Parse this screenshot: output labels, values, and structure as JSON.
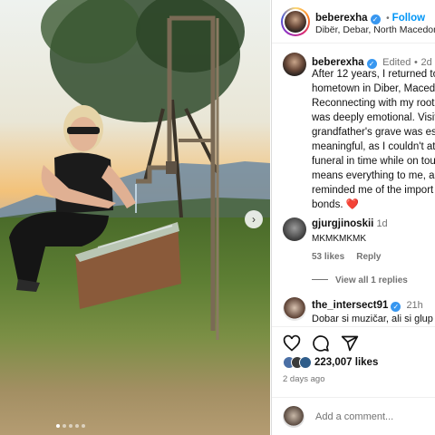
{
  "post": {
    "author": "beberexha",
    "follow_label": "Follow",
    "location": "Dibër, Debar, North Macedonia",
    "edited_label": "Edited",
    "edited_time": "2d",
    "caption_lines": [
      "After 12 years, I returned to",
      "hometown in Diber, Maced",
      "Reconnecting with my roots",
      "was deeply emotional. Visit",
      "grandfather's grave was esp",
      "meaningful, as I couldn't att",
      "funeral in time while on tou",
      "means everything to me, ar",
      "reminded me of the import",
      "bonds."
    ],
    "heart_emoji": "❤️"
  },
  "comments": [
    {
      "username": "gjurgjinoskii",
      "time": "1d",
      "text": "MKMKMKMK",
      "likes": "53 likes",
      "reply_label": "Reply"
    },
    {
      "username": "the_intersect91",
      "time": "21h",
      "text": "Dobar si muzičar, ali si glup"
    }
  ],
  "view_replies": "View all 1 replies",
  "likes": {
    "count": "223,007 likes"
  },
  "posted_ago": "2 days ago",
  "add_comment_placeholder": "Add a comment...",
  "carousel": {
    "next_icon": "›",
    "dot_count": 5,
    "active_index": 0
  },
  "colors": {
    "accent": "#0095f6",
    "verified": "#3897f0",
    "heart": "#ed4956"
  }
}
